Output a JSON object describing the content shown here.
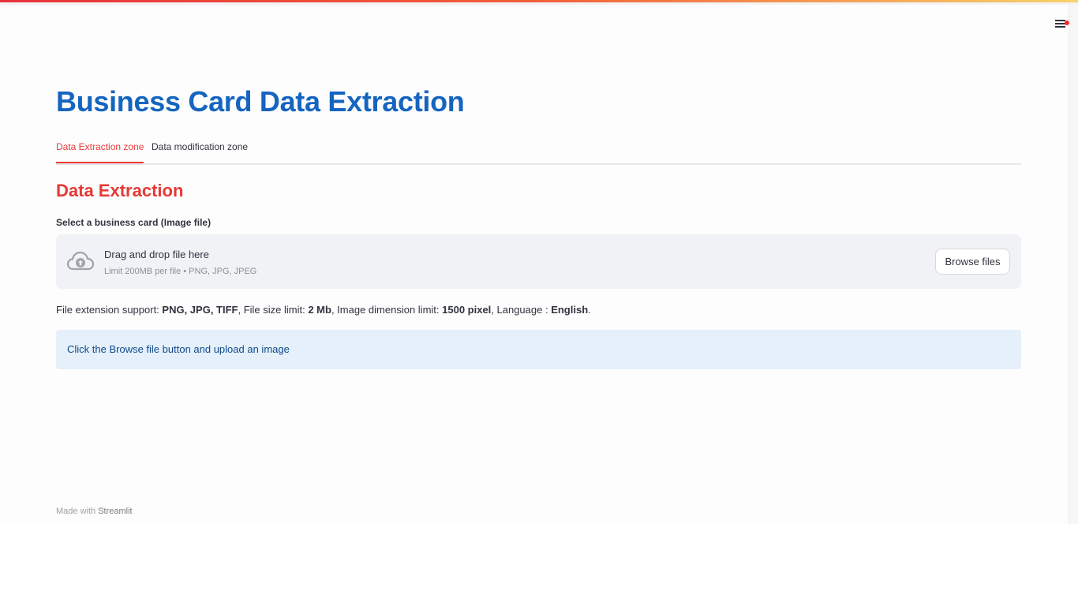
{
  "app": {
    "title": "Business Card Data Extraction",
    "accent_color": "#ea3b3b",
    "title_color": "#1565c0"
  },
  "header": {
    "menu_icon": "hamburger-menu-icon",
    "notification_dot_color": "#ff2b2b"
  },
  "tabs": [
    {
      "label": "Data Extraction zone",
      "active": true
    },
    {
      "label": "Data modification zone",
      "active": false
    }
  ],
  "section": {
    "heading": "Data Extraction"
  },
  "uploader": {
    "label": "Select a business card (Image file)",
    "drop_text": "Drag and drop file here",
    "limit_text": "Limit 200MB per file • PNG, JPG, JPEG",
    "browse_label": "Browse files",
    "icon": "cloud-upload-icon"
  },
  "support_info": {
    "ext_label": "File extension support: ",
    "ext_value": "PNG, JPG, TIFF",
    "size_label": ", File size limit: ",
    "size_value": "2 Mb",
    "dim_label": ", Image dimension limit: ",
    "dim_value": "1500 pixel",
    "lang_label": ", Language : ",
    "lang_value": "English",
    "end": "."
  },
  "alert": {
    "text": "Click the Browse file button and upload an image"
  },
  "footer": {
    "prefix": "Made with ",
    "brand": "Streamlit"
  }
}
